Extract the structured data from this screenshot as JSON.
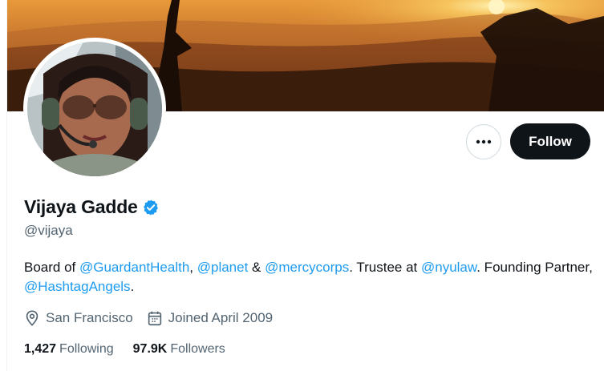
{
  "profile": {
    "name": "Vijaya Gadde",
    "handle": "@vijaya",
    "verified": true,
    "banner_icon": "sunset-photo",
    "avatar_icon": "profile-photo"
  },
  "actions": {
    "more_icon": "more-horizontal-icon",
    "follow_label": "Follow"
  },
  "bio": [
    {
      "text": "Board of ",
      "type": "text"
    },
    {
      "text": "@GuardantHealth",
      "type": "mention"
    },
    {
      "text": ", ",
      "type": "text"
    },
    {
      "text": "@planet",
      "type": "mention"
    },
    {
      "text": " & ",
      "type": "text"
    },
    {
      "text": "@mercycorps",
      "type": "mention"
    },
    {
      "text": ". Trustee at ",
      "type": "text"
    },
    {
      "text": "@nyulaw",
      "type": "mention"
    },
    {
      "text": ". Founding Partner, ",
      "type": "text"
    },
    {
      "text": "@HashtagAngels",
      "type": "mention"
    },
    {
      "text": ".",
      "type": "text"
    }
  ],
  "meta": {
    "location": "San Francisco",
    "location_icon": "location-pin-icon",
    "joined": "Joined April 2009",
    "joined_icon": "calendar-icon"
  },
  "stats": {
    "following_count": "1,427",
    "following_label": "Following",
    "followers_count": "97.9K",
    "followers_label": "Followers"
  },
  "colors": {
    "accent": "#1d9bf0",
    "primary_text": "#0f1419",
    "secondary_text": "#536471",
    "follow_bg": "#0f1419"
  }
}
